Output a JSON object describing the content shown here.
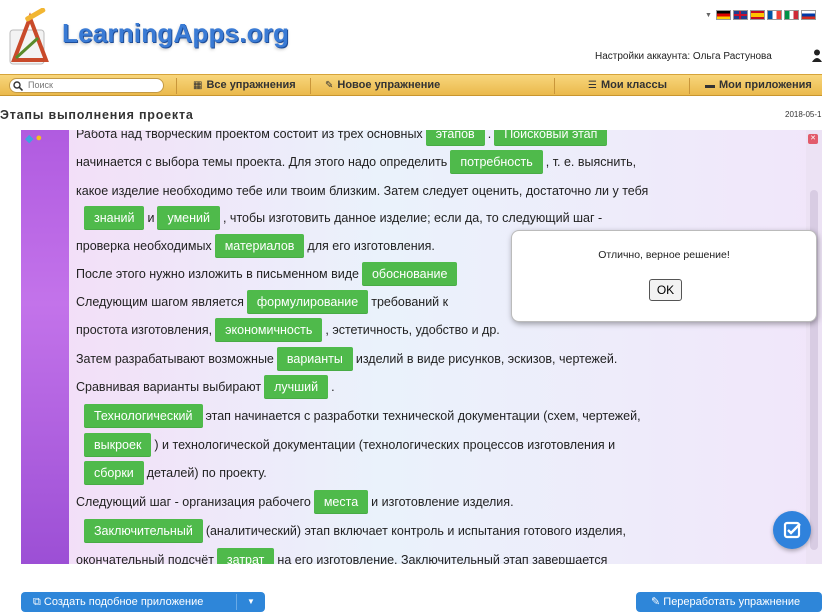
{
  "header": {
    "logo_text": "LearningApps.org",
    "account_label": "Настройки аккаунта: Ольга Растунова"
  },
  "nav": {
    "search_placeholder": "Поиск",
    "all_exercises": "Все упражнения",
    "new_exercise": "Новое упражнение",
    "my_classes": "Мои классы",
    "my_apps": "Мои приложения"
  },
  "page": {
    "title": "Этапы выполнения проекта",
    "date": "2018-05-1"
  },
  "exercise": {
    "lines": [
      [
        {
          "t": "Работа над творческим проектом состоит из трех основных "
        },
        {
          "c": "этапов"
        },
        {
          "t": ". "
        },
        {
          "c": "Поисковый этап"
        }
      ],
      [
        {
          "t": "начинается с выбора темы проекта. Для этого надо определить "
        },
        {
          "c": "потребность"
        },
        {
          "t": ", т. е. выяснить,"
        }
      ],
      [
        {
          "t": "какое изделие необходимо тебе или твоим близким. Затем следует оценить, достаточно ли у тебя"
        }
      ],
      [
        {
          "c": "знаний"
        },
        {
          "t": " и "
        },
        {
          "c": "умений"
        },
        {
          "t": ", чтобы изготовить данное изделие; если да, то следующий шаг -"
        }
      ],
      [
        {
          "t": "проверка необходимых "
        },
        {
          "c": "материалов"
        },
        {
          "t": " для его изготовления."
        }
      ],
      [
        {
          "t": "После этого нужно изложить в письменном виде "
        },
        {
          "c": "обоснование"
        }
      ],
      [
        {
          "t": "Следующим шагом является "
        },
        {
          "c": "формулирование"
        },
        {
          "t": " требований к"
        }
      ],
      [
        {
          "t": "простота изготовления, "
        },
        {
          "c": "экономичность"
        },
        {
          "t": ", эстетичность, удобство и др."
        }
      ],
      [
        {
          "t": "Затем разрабатывают возможные "
        },
        {
          "c": "варианты"
        },
        {
          "t": " изделий в виде рисунков, эскизов, чертежей."
        }
      ],
      [
        {
          "t": "Сравнивая варианты выбирают "
        },
        {
          "c": "лучший"
        },
        {
          "t": "."
        }
      ],
      [
        {
          "c": "Технологический"
        },
        {
          "t": " этап начинается с разработки технической документации (схем, чертежей,"
        }
      ],
      [
        {
          "c": "выкроек"
        },
        {
          "t": ") и технологической документации (технологических процессов изготовления и"
        }
      ],
      [
        {
          "c": "сборки"
        },
        {
          "t": " деталей) по проекту."
        }
      ],
      [
        {
          "t": "Следующий шаг - организация рабочего "
        },
        {
          "c": "места"
        },
        {
          "t": " и изготовление изделия."
        }
      ],
      [
        {
          "c": "Заключительный"
        },
        {
          "t": " (аналитический) этап включает контроль и испытания готового изделия,"
        }
      ],
      [
        {
          "t": "окончательный подсчёт "
        },
        {
          "c": "затрат"
        },
        {
          "t": " на его изготовление. Заключительный этап завершается"
        }
      ]
    ]
  },
  "dialog": {
    "message": "Отлично, верное решение!",
    "ok_label": "OK"
  },
  "footer": {
    "create_similar": "Создать подобное приложение",
    "rework": "Переработать упражнение"
  },
  "colors": {
    "chip": "#4fba4b",
    "nav": "#eab94c",
    "primary_button": "#2e86d9"
  }
}
